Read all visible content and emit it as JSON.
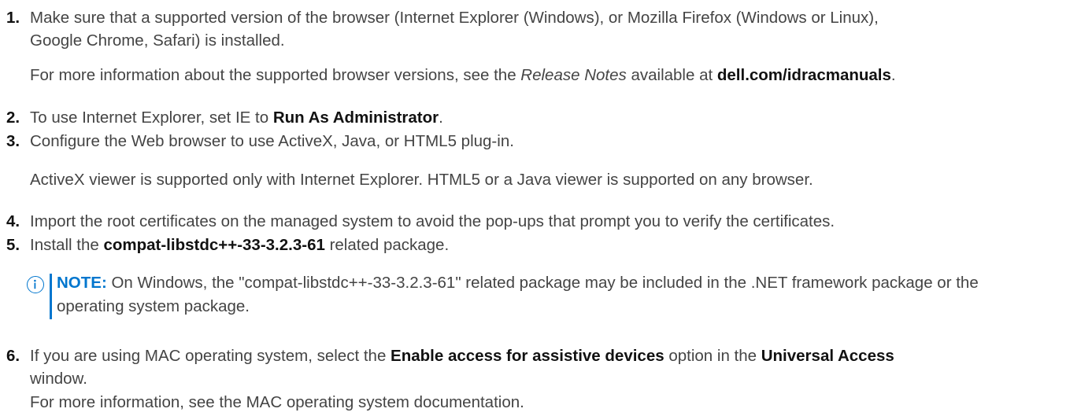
{
  "steps": [
    {
      "number": "1",
      "lines": [
        "Make sure that a supported version of the browser (Internet Explorer (Windows), or Mozilla Firefox (Windows or Linux),",
        "Google Chrome, Safari) is installed."
      ],
      "paragraph": {
        "pre": "For more information about the supported browser versions, see the ",
        "italic": "Release Notes",
        "mid": " available at ",
        "bold": "dell.com/idracmanuals",
        "post": "."
      }
    },
    {
      "number": "2",
      "pre": "To use Internet Explorer, set IE to ",
      "bold": "Run As Administrator",
      "post": "."
    },
    {
      "number": "3",
      "text": "Configure the Web browser to use ActiveX, Java, or HTML5 plug-in.",
      "paragraph": "ActiveX viewer is supported only with Internet Explorer. HTML5 or a Java viewer is supported on any browser."
    },
    {
      "number": "4",
      "text": "Import the root certificates on the managed system to avoid the pop-ups that prompt you to verify the certificates."
    },
    {
      "number": "5",
      "pre": "Install the ",
      "bold": "compat-libstdc++-33-3.2.3-61",
      "post": " related package.",
      "note": {
        "icon": "info-icon",
        "label": "NOTE:",
        "text": " On Windows, the \"compat-libstdc++-33-3.2.3-61\" related package may be included in the .NET framework package or the operating system package."
      }
    },
    {
      "number": "6",
      "pre": "If you are using MAC operating system, select the ",
      "bold1": "Enable access for assistive devices",
      "mid": " option in the ",
      "bold2": "Universal Access",
      "line2": "window.",
      "paragraph": "For more information, see the MAC operating system documentation."
    }
  ],
  "colors": {
    "body_text": "#444444",
    "emphasis_text": "#111111",
    "note_accent": "#0076CE"
  }
}
